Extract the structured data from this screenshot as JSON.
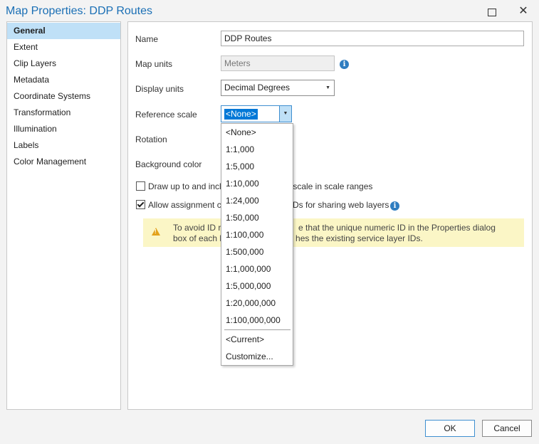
{
  "window": {
    "title": "Map Properties: DDP Routes",
    "maximize_label": "",
    "close_label": "✕"
  },
  "nav": {
    "items": [
      "General",
      "Extent",
      "Clip Layers",
      "Metadata",
      "Coordinate Systems",
      "Transformation",
      "Illumination",
      "Labels",
      "Color Management"
    ],
    "selected": "General"
  },
  "general": {
    "name_label": "Name",
    "name_value": "DDP Routes",
    "map_units_label": "Map units",
    "map_units_value": "Meters",
    "display_units_label": "Display units",
    "display_units_value": "Decimal Degrees",
    "reference_scale_label": "Reference scale",
    "reference_scale_value": "<None>",
    "rotation_label": "Rotation",
    "background_color_label": "Background color",
    "draw_checkbox_label": "Draw up to and incl",
    "draw_checkbox_tail": "m scale in scale ranges",
    "draw_checked": false,
    "allow_checkbox_label": "Allow assignment c",
    "allow_checkbox_tail": "Ds for sharing web layers",
    "allow_checked": true,
    "warning_line1_a": "To avoid ID re",
    "warning_line1_b": "e that the unique numeric ID in the Properties dialog",
    "warning_line2_a": "box of each l",
    "warning_line2_b": "hes the existing service layer IDs."
  },
  "dropdown": {
    "options": [
      "<None>",
      "1:1,000",
      "1:5,000",
      "1:10,000",
      "1:24,000",
      "1:50,000",
      "1:100,000",
      "1:500,000",
      "1:1,000,000",
      "1:5,000,000",
      "1:20,000,000",
      "1:100,000,000"
    ],
    "extra_options": [
      "<Current>",
      "Customize..."
    ]
  },
  "footer": {
    "ok_label": "OK",
    "cancel_label": "Cancel"
  },
  "colors": {
    "accent": "#0078d7",
    "selection": "#bfe0f7",
    "warning_bg": "#fbf6c6",
    "title": "#1a6fb5"
  }
}
